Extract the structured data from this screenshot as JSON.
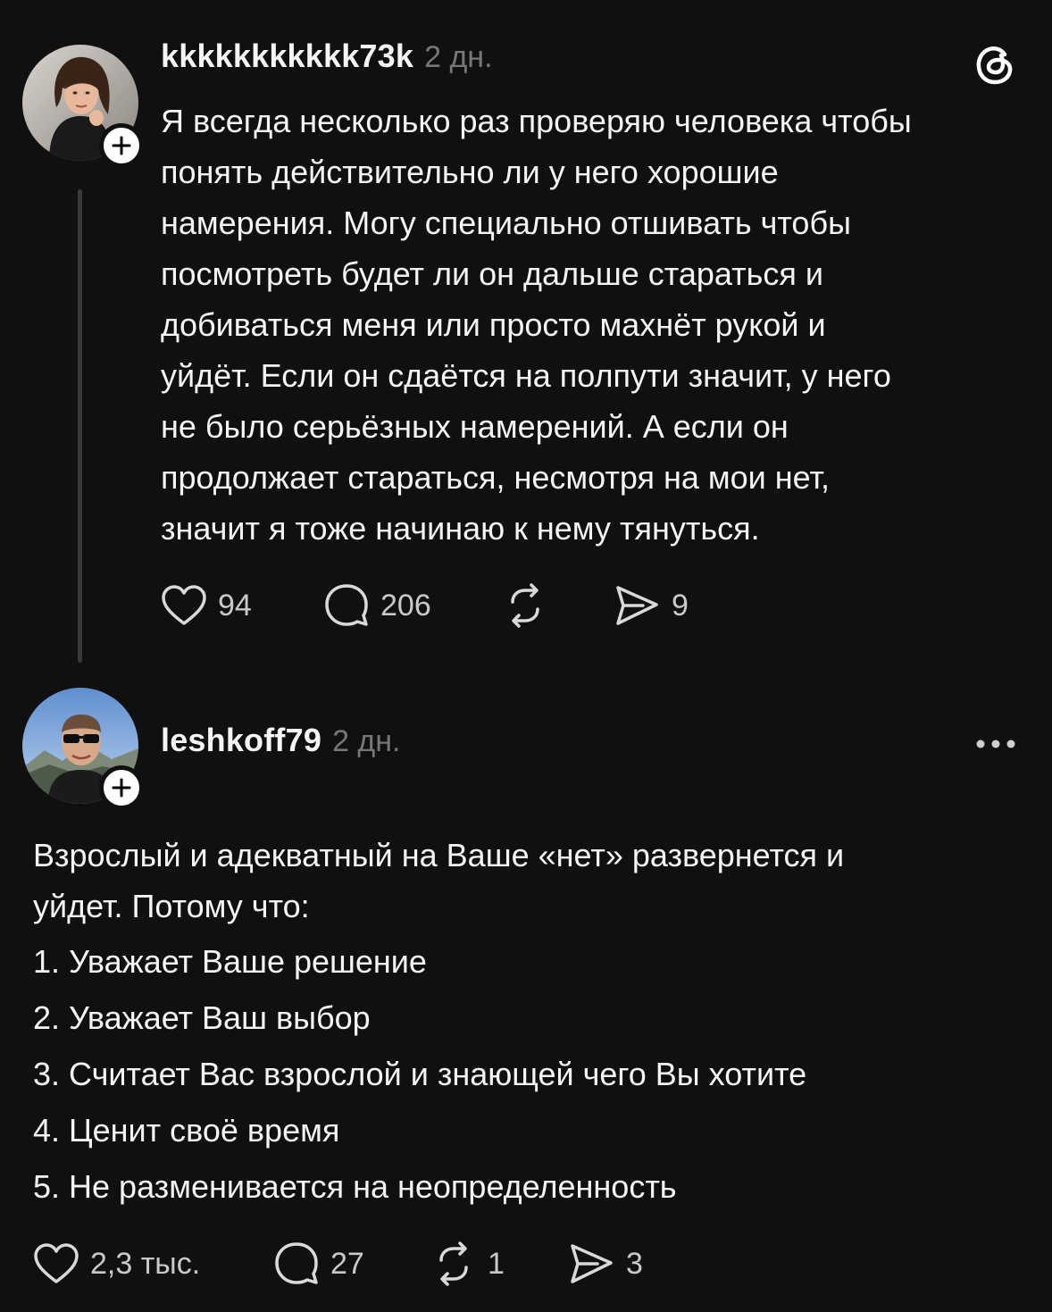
{
  "post": {
    "username": "kkkkkkkkkkk73k",
    "time": "2 дн.",
    "lines": [
      "Я всегда несколько раз проверяю человека чтобы",
      "понять действительно ли у него хорошие",
      "намерения. Могу специально отшивать чтобы",
      "посмотреть будет ли он дальше стараться и",
      "добиваться меня или просто махнёт рукой и",
      "уйдёт. Если он сдаётся на полпути значит, у него",
      "не было серьёзных намерений. А если он",
      "продолжает стараться, несмотря на мои нет,",
      "значит я тоже начинаю к нему тянуться."
    ],
    "actions": {
      "likes": "94",
      "comments": "206",
      "shares": "9"
    },
    "icons": [
      "heart-icon",
      "comment-icon",
      "repost-icon",
      "share-icon",
      "threads-logo-icon",
      "plus-icon"
    ]
  },
  "reply": {
    "username": "leshkoff79",
    "time": "2 дн.",
    "lines": [
      "Взрослый и адекватный на Ваше «нет» развернется и",
      "уйдет. Потому что:"
    ],
    "list": [
      "1. Уважает Ваше решение",
      "2. Уважает Ваш выбор",
      "3. Считает Вас взрослой и знающей чего Вы хотите",
      "4. Ценит своё время",
      "5. Не разменивается на неопределенность"
    ],
    "actions": {
      "likes": "2,3 тыс.",
      "comments": "27",
      "reposts": "1",
      "shares": "3"
    },
    "icons": [
      "heart-icon",
      "comment-icon",
      "repost-icon",
      "share-icon",
      "more-icon",
      "plus-icon"
    ]
  },
  "colors": {
    "background": "#101010",
    "text": "#f3f5f7",
    "muted": "#777777",
    "thread_line": "#3a3a3a"
  }
}
